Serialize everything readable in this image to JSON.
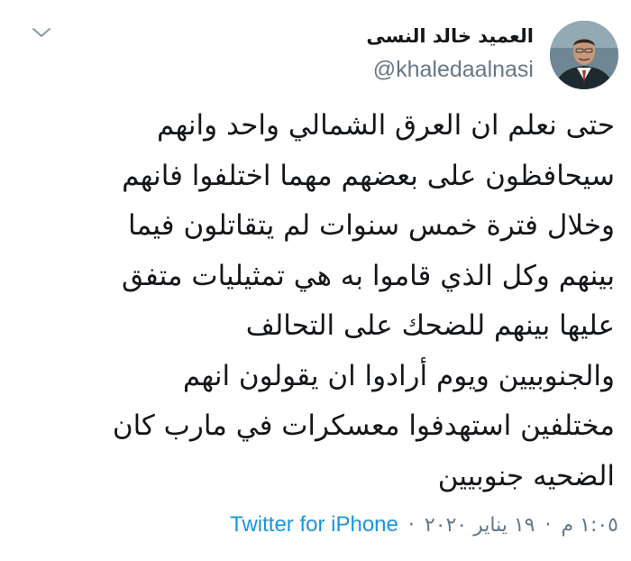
{
  "author": {
    "display_name": "العميد خالد النسى",
    "handle": "@khaledaalnasi"
  },
  "icons": {
    "menu": "chevron-down-icon",
    "avatar": "profile-photo"
  },
  "tweet": {
    "lines": [
      "حتى نعلم ان العرق الشمالي واحد وانهم",
      "سيحافظون على بعضهم مهما اختلفوا فانهم",
      "وخلال فترة خمس سنوات لم يتقاتلون فيما",
      "بينهم وكل الذي قاموا به هي تمثيليات متفق",
      "عليها بينهم  للضحك على التحالف",
      "والجنوبيين ويوم أرادوا ان يقولون انهم",
      "مختلفين استهدفوا معسكرات في مارب كان",
      "الضحيه جنوبيين"
    ]
  },
  "meta": {
    "time": "١:٠٥ م",
    "date": "١٩ يناير ٢٠٢٠",
    "separator": "·",
    "source": "Twitter for iPhone"
  },
  "colors": {
    "text": "#14171a",
    "secondary": "#657786",
    "link": "#1b95e0",
    "background": "#ffffff"
  }
}
